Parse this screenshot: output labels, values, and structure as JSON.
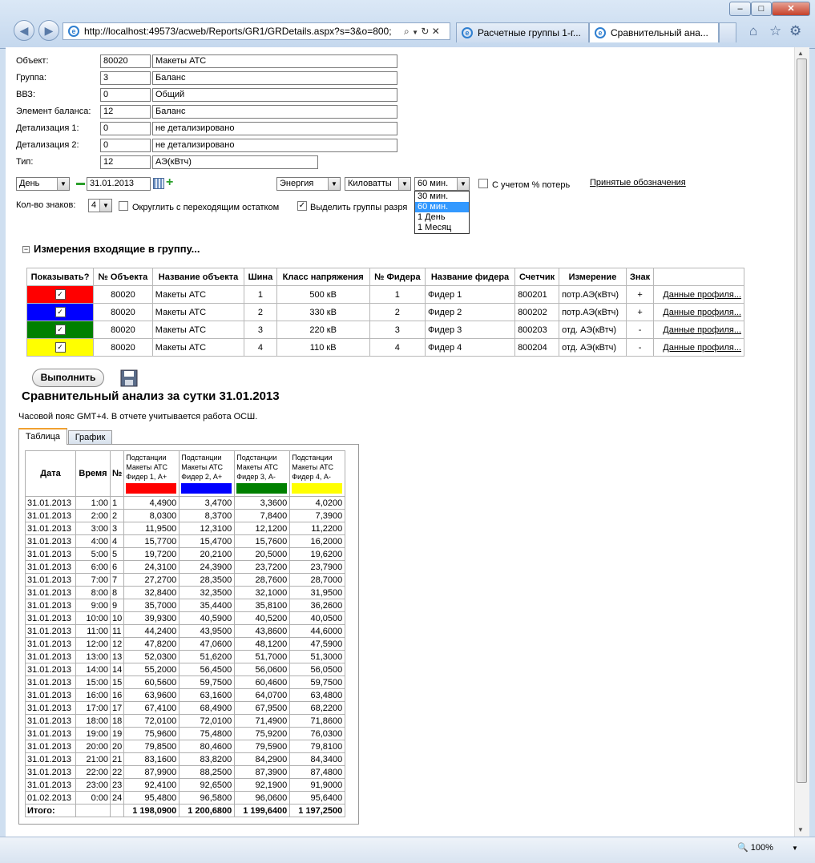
{
  "window": {
    "min": "–",
    "max": "□",
    "close": "✕"
  },
  "address": {
    "url": "http://localhost:49573/acweb/Reports/GR1/GRDetails.aspx?s=3&o=800;"
  },
  "tabs": [
    {
      "label": "Расчетные группы 1-г..."
    },
    {
      "label": "Сравнительный ана..."
    }
  ],
  "form": {
    "rows": [
      {
        "label": "Объект:",
        "code": "80020",
        "name": "Макеты АТС"
      },
      {
        "label": "Группа:",
        "code": "3",
        "name": "Баланс"
      },
      {
        "label": "ВВЗ:",
        "code": "0",
        "name": "Общий"
      },
      {
        "label": "Элемент баланса:",
        "code": "12",
        "name": "Баланс"
      },
      {
        "label": "Детализация 1:",
        "code": "0",
        "name": "не детализировано"
      },
      {
        "label": "Детализация 2:",
        "code": "0",
        "name": "не детализировано"
      },
      {
        "label": "Тип:",
        "code": "12",
        "name": "АЭ(кВтч)"
      }
    ],
    "period": "День",
    "date": "31.01.2013",
    "energy": "Энергия",
    "units": "Киловатты",
    "interval": "60 мин.",
    "interval_options": [
      "30 мин.",
      "60 мин.",
      "1 День",
      "1 Месяц"
    ],
    "losses_label": "С учетом % потерь",
    "legend_link": "Принятые обозначения",
    "digits_label": "Кол-во знаков:",
    "digits": "4",
    "round_label": "Округлить с переходящим остатком",
    "highlight_label": "Выделить группы разря"
  },
  "measurements": {
    "title": "Измерения входящие в группу...",
    "columns": [
      "Показывать?",
      "№ Объекта",
      "Название объекта",
      "Шина",
      "Класс напряжения",
      "№ Фидера",
      "Название фидера",
      "Счетчик",
      "Измерение",
      "Знак",
      ""
    ],
    "rows": [
      {
        "color": "#ff0000",
        "obj": "80020",
        "name": "Макеты АТС",
        "bus": "1",
        "volt": "500 кВ",
        "fnum": "1",
        "fname": "Фидер 1",
        "meter": "800201",
        "meas": "потр.АЭ(кВтч)",
        "sign": "+",
        "link": "Данные профиля..."
      },
      {
        "color": "#0000ff",
        "obj": "80020",
        "name": "Макеты АТС",
        "bus": "2",
        "volt": "330 кВ",
        "fnum": "2",
        "fname": "Фидер 2",
        "meter": "800202",
        "meas": "потр.АЭ(кВтч)",
        "sign": "+",
        "link": "Данные профиля..."
      },
      {
        "color": "#008000",
        "obj": "80020",
        "name": "Макеты АТС",
        "bus": "3",
        "volt": "220 кВ",
        "fnum": "3",
        "fname": "Фидер 3",
        "meter": "800203",
        "meas": "отд. АЭ(кВтч)",
        "sign": "-",
        "link": "Данные профиля..."
      },
      {
        "color": "#ffff00",
        "obj": "80020",
        "name": "Макеты АТС",
        "bus": "4",
        "volt": "110 кВ",
        "fnum": "4",
        "fname": "Фидер 4",
        "meter": "800204",
        "meas": "отд. АЭ(кВтч)",
        "sign": "-",
        "link": "Данные профиля..."
      }
    ]
  },
  "run_button": "Выполнить",
  "report": {
    "title": "Сравнительный анализ за сутки 31.01.2013",
    "note": "Часовой пояс GMT+4. В отчете учитывается работа ОСШ.",
    "tabs": [
      "Таблица",
      "График"
    ],
    "headers": {
      "date": "Дата",
      "time": "Время",
      "num": "№"
    },
    "series": [
      {
        "l1": "Подстанции",
        "l2": "Макеты АТС",
        "l3": "Фидер 1, А+",
        "color": "#ff0000"
      },
      {
        "l1": "Подстанции",
        "l2": "Макеты АТС",
        "l3": "Фидер 2, А+",
        "color": "#0000ff"
      },
      {
        "l1": "Подстанции",
        "l2": "Макеты АТС",
        "l3": "Фидер 3, А-",
        "color": "#008000"
      },
      {
        "l1": "Подстанции",
        "l2": "Макеты АТС",
        "l3": "Фидер 4, А-",
        "color": "#ffff00"
      }
    ],
    "rows": [
      [
        "31.01.2013",
        "1:00",
        "1",
        "4,4900",
        "3,4700",
        "3,3600",
        "4,0200"
      ],
      [
        "31.01.2013",
        "2:00",
        "2",
        "8,0300",
        "8,3700",
        "7,8400",
        "7,3900"
      ],
      [
        "31.01.2013",
        "3:00",
        "3",
        "11,9500",
        "12,3100",
        "12,1200",
        "11,2200"
      ],
      [
        "31.01.2013",
        "4:00",
        "4",
        "15,7700",
        "15,4700",
        "15,7600",
        "16,2000"
      ],
      [
        "31.01.2013",
        "5:00",
        "5",
        "19,7200",
        "20,2100",
        "20,5000",
        "19,6200"
      ],
      [
        "31.01.2013",
        "6:00",
        "6",
        "24,3100",
        "24,3900",
        "23,7200",
        "23,7900"
      ],
      [
        "31.01.2013",
        "7:00",
        "7",
        "27,2700",
        "28,3500",
        "28,7600",
        "28,7000"
      ],
      [
        "31.01.2013",
        "8:00",
        "8",
        "32,8400",
        "32,3500",
        "32,1000",
        "31,9500"
      ],
      [
        "31.01.2013",
        "9:00",
        "9",
        "35,7000",
        "35,4400",
        "35,8100",
        "36,2600"
      ],
      [
        "31.01.2013",
        "10:00",
        "10",
        "39,9300",
        "40,5900",
        "40,5200",
        "40,0500"
      ],
      [
        "31.01.2013",
        "11:00",
        "11",
        "44,2400",
        "43,9500",
        "43,8600",
        "44,6000"
      ],
      [
        "31.01.2013",
        "12:00",
        "12",
        "47,8200",
        "47,0600",
        "48,1200",
        "47,5900"
      ],
      [
        "31.01.2013",
        "13:00",
        "13",
        "52,0300",
        "51,6200",
        "51,7000",
        "51,3000"
      ],
      [
        "31.01.2013",
        "14:00",
        "14",
        "55,2000",
        "56,4500",
        "56,0600",
        "56,0500"
      ],
      [
        "31.01.2013",
        "15:00",
        "15",
        "60,5600",
        "59,7500",
        "60,4600",
        "59,7500"
      ],
      [
        "31.01.2013",
        "16:00",
        "16",
        "63,9600",
        "63,1600",
        "64,0700",
        "63,4800"
      ],
      [
        "31.01.2013",
        "17:00",
        "17",
        "67,4100",
        "68,4900",
        "67,9500",
        "68,2200"
      ],
      [
        "31.01.2013",
        "18:00",
        "18",
        "72,0100",
        "72,0100",
        "71,4900",
        "71,8600"
      ],
      [
        "31.01.2013",
        "19:00",
        "19",
        "75,9600",
        "75,4800",
        "75,9200",
        "76,0300"
      ],
      [
        "31.01.2013",
        "20:00",
        "20",
        "79,8500",
        "80,4600",
        "79,5900",
        "79,8100"
      ],
      [
        "31.01.2013",
        "21:00",
        "21",
        "83,1600",
        "83,8200",
        "84,2900",
        "84,3400"
      ],
      [
        "31.01.2013",
        "22:00",
        "22",
        "87,9900",
        "88,2500",
        "87,3900",
        "87,4800"
      ],
      [
        "31.01.2013",
        "23:00",
        "23",
        "92,4100",
        "92,6500",
        "92,1900",
        "91,9000"
      ],
      [
        "01.02.2013",
        "0:00",
        "24",
        "95,4800",
        "96,5800",
        "96,0600",
        "95,6400"
      ]
    ],
    "total": {
      "label": "Итого:",
      "values": [
        "1 198,0900",
        "1 200,6800",
        "1 199,6400",
        "1 197,2500"
      ]
    }
  },
  "statusbar": {
    "zoom": "100%"
  }
}
